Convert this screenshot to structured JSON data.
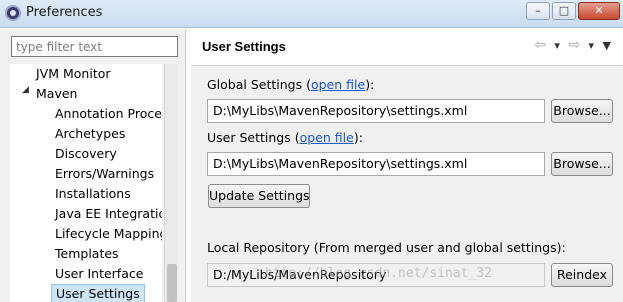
{
  "window": {
    "title": "Preferences",
    "minimize_glyph": "–",
    "maximize_glyph": "□",
    "close_glyph": "✕"
  },
  "sidebar": {
    "filter_placeholder": "type filter text",
    "items": [
      {
        "label": "JVM Monitor"
      },
      {
        "label": "Maven",
        "expanded": true
      },
      {
        "label": "Annotation Processing"
      },
      {
        "label": "Archetypes"
      },
      {
        "label": "Discovery"
      },
      {
        "label": "Errors/Warnings"
      },
      {
        "label": "Installations"
      },
      {
        "label": "Java EE Integration"
      },
      {
        "label": "Lifecycle Mapping"
      },
      {
        "label": "Templates"
      },
      {
        "label": "User Interface"
      },
      {
        "label": "User Settings",
        "selected": true
      }
    ],
    "expand_arrow": "◢"
  },
  "main": {
    "title": "User Settings",
    "nav": {
      "back_icon": "⇦",
      "back_dropdown": "▾",
      "forward_icon": "⇨",
      "forward_dropdown": "▾",
      "menu_icon": "▼"
    },
    "global_settings": {
      "label_prefix": "Global Settings (",
      "link": "open file",
      "label_suffix": "):",
      "value": "D:\\MyLibs\\MavenRepository\\settings.xml",
      "browse_label": "Browse..."
    },
    "user_settings": {
      "label_prefix": "User Settings (",
      "link": "open file",
      "label_suffix": "):",
      "value": "D:\\MyLibs\\MavenRepository\\settings.xml",
      "browse_label": "Browse..."
    },
    "update_button_label": "Update Settings",
    "local_repository": {
      "label": "Local Repository (From merged user and global settings):",
      "value": "D:/MyLibs/MavenRepository",
      "reindex_label": "Reindex"
    }
  },
  "watermark": "http://blog.csdn.net/sinat_32"
}
